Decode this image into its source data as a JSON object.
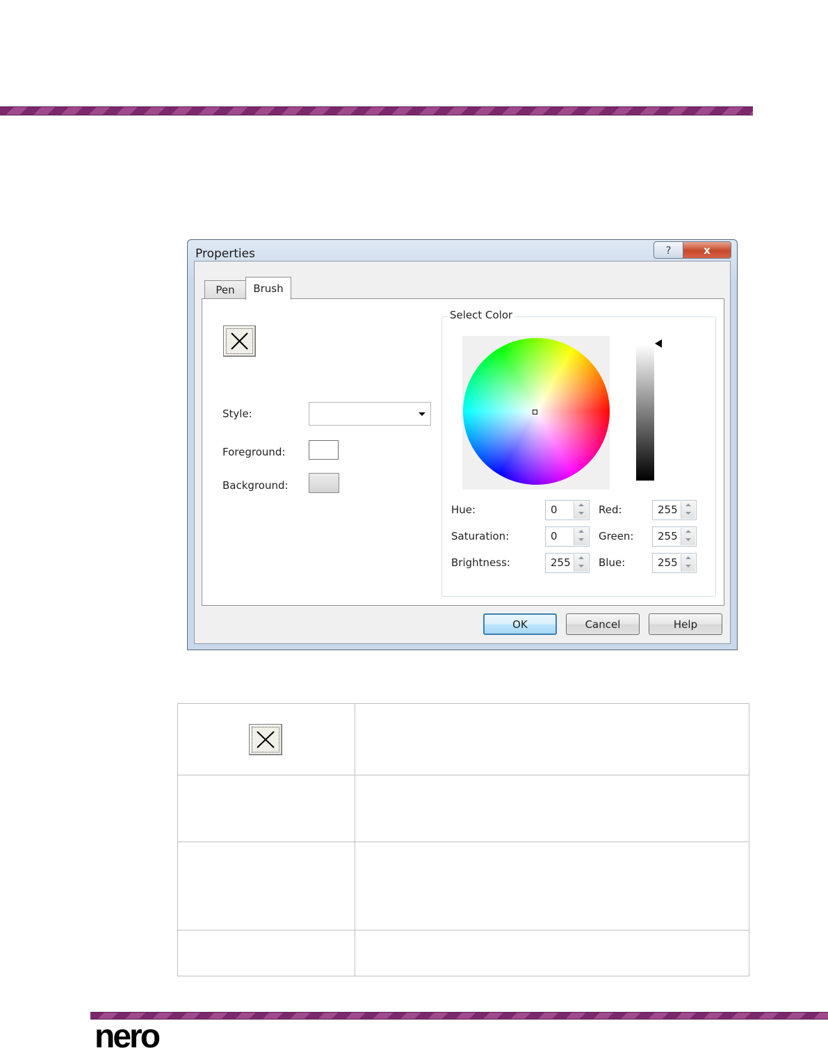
{
  "dialog": {
    "title": "Properties",
    "caption_help": "?",
    "caption_close": "x",
    "tabs": [
      {
        "label": "Pen",
        "active": false
      },
      {
        "label": "Brush",
        "active": true
      }
    ],
    "style_label": "Style:",
    "foreground_label": "Foreground:",
    "background_label": "Background:",
    "style_value": "",
    "select_color_label": "Select Color",
    "hue_label": "Hue:",
    "saturation_label": "Saturation:",
    "brightness_label": "Brightness:",
    "red_label": "Red:",
    "green_label": "Green:",
    "blue_label": "Blue:",
    "values": {
      "hue": "0",
      "saturation": "0",
      "brightness": "255",
      "red": "255",
      "green": "255",
      "blue": "255"
    },
    "buttons": {
      "ok": "OK",
      "cancel": "Cancel",
      "help": "Help"
    },
    "colors": {
      "foreground": "#ffffff",
      "background": "#e0e0e0"
    }
  },
  "icons": [
    "none-brush-icon",
    "dropdown-arrow-icon",
    "help-icon",
    "close-icon",
    "spin-up-icon",
    "spin-down-icon"
  ],
  "logo": "nero"
}
